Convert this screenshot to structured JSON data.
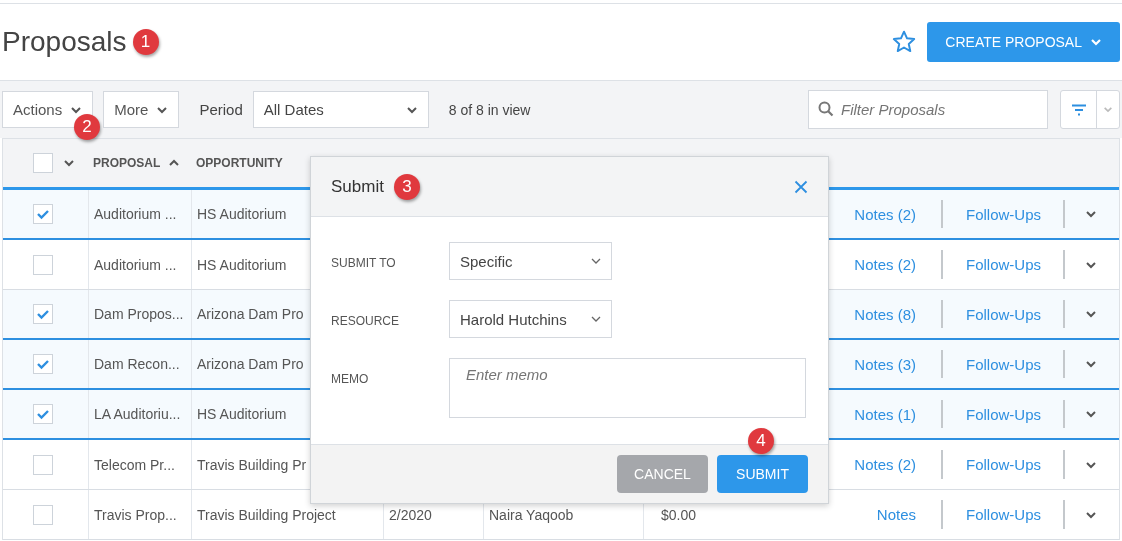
{
  "page": {
    "title": "Proposals",
    "title_badge": "1",
    "create_button": "CREATE PROPOSAL"
  },
  "toolbar": {
    "actions": "Actions",
    "actions_badge": "2",
    "more": "More",
    "period_label": "Period",
    "period_value": "All Dates",
    "count": "8 of 8 in view",
    "filter_placeholder": "Filter Proposals"
  },
  "table": {
    "select_all_checked": false,
    "columns": [
      {
        "label": "PROPOSAL",
        "sorted": true
      },
      {
        "label": "OPPORTUNITY",
        "sorted": false
      }
    ],
    "rows": [
      {
        "checked": true,
        "proposal": "Auditorium ...",
        "opportunity": "HS Auditorium",
        "notes": "Notes (2)",
        "follow_ups": "Follow-Ups"
      },
      {
        "checked": false,
        "proposal": "Auditorium ...",
        "opportunity": "HS Auditorium",
        "notes": "Notes (2)",
        "follow_ups": "Follow-Ups"
      },
      {
        "checked": true,
        "proposal": "Dam Propos...",
        "opportunity": "Arizona Dam Pro",
        "notes": "Notes (8)",
        "follow_ups": "Follow-Ups"
      },
      {
        "checked": true,
        "proposal": "Dam Recon...",
        "opportunity": "Arizona Dam Pro",
        "notes": "Notes (3)",
        "follow_ups": "Follow-Ups"
      },
      {
        "checked": true,
        "proposal": "LA Auditoriu...",
        "opportunity": "HS Auditorium",
        "notes": "Notes (1)",
        "follow_ups": "Follow-Ups"
      },
      {
        "checked": false,
        "proposal": "Telecom Pr...",
        "opportunity": "Travis Building Pr",
        "notes": "Notes (2)",
        "follow_ups": "Follow-Ups"
      },
      {
        "checked": false,
        "proposal": "Travis Prop...",
        "opportunity": "Travis Building Project",
        "date": "2/2020",
        "owner": "Naira Yaqoob",
        "amount": "$0.00",
        "notes": "Notes",
        "follow_ups": "Follow-Ups"
      }
    ]
  },
  "dialog": {
    "title": "Submit",
    "badge": "3",
    "fields": [
      {
        "kind": "select",
        "label": "SUBMIT TO",
        "value": "Specific"
      },
      {
        "kind": "select",
        "label": "RESOURCE",
        "value": "Harold Hutchins"
      },
      {
        "kind": "textarea",
        "label": "MEMO",
        "placeholder": "Enter memo"
      }
    ],
    "buttons": [
      {
        "kind": "secondary",
        "label": "CANCEL"
      },
      {
        "kind": "primary",
        "label": "SUBMIT",
        "badge": "4"
      }
    ]
  }
}
